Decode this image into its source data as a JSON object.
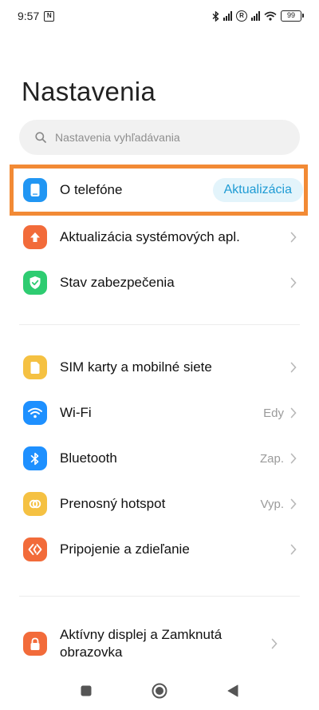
{
  "status_bar": {
    "time": "9:57",
    "battery": "99"
  },
  "page": {
    "title": "Nastavenia"
  },
  "search": {
    "placeholder": "Nastavenia vyhľadávania"
  },
  "sections": [
    [
      {
        "label": "O telefóne",
        "badge": "Aktualizácia",
        "icon": "phone-icon",
        "color": "#2196f3"
      },
      {
        "label": "Aktualizácia systémových apl.",
        "icon": "arrow-up-icon",
        "color": "#f26b3a"
      },
      {
        "label": "Stav zabezpečenia",
        "icon": "shield-check-icon",
        "color": "#2ecc71"
      }
    ],
    [
      {
        "label": "SIM karty a mobilné siete",
        "icon": "sim-card-icon",
        "color": "#f5c142"
      },
      {
        "label": "Wi-Fi",
        "value": "Edy",
        "icon": "wifi-icon",
        "color": "#1e90ff"
      },
      {
        "label": "Bluetooth",
        "value": "Zap.",
        "icon": "bluetooth-icon",
        "color": "#1e90ff"
      },
      {
        "label": "Prenosný hotspot",
        "value": "Vyp.",
        "icon": "hotspot-icon",
        "color": "#f5c142"
      },
      {
        "label": "Pripojenie a zdieľanie",
        "icon": "share-connection-icon",
        "color": "#f26b3a"
      }
    ],
    [
      {
        "label": "Aktívny displej a Zamknutá obrazovka",
        "icon": "lock-icon",
        "color": "#f26b3a"
      }
    ]
  ],
  "colors": {
    "highlight": "#f28a35",
    "accent": "#1e9bd4"
  }
}
